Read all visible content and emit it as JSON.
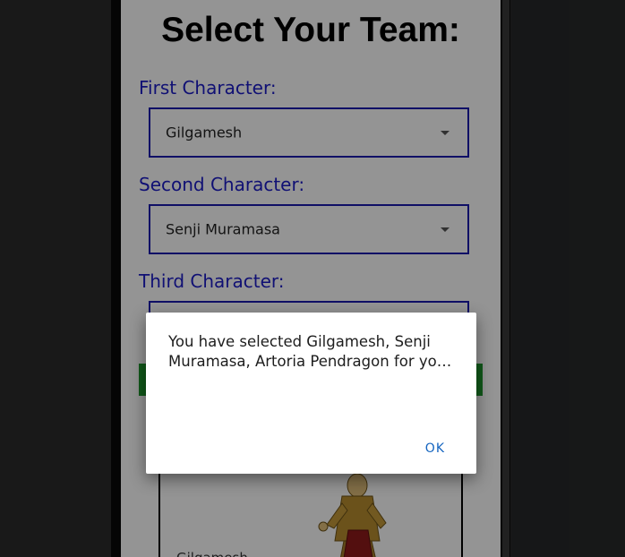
{
  "app": {
    "title": "Select Your Team:"
  },
  "characters": [
    {
      "label": "First Character:",
      "selected": "Gilgamesh"
    },
    {
      "label": "Second Character:",
      "selected": "Senji Muramasa"
    },
    {
      "label": "Third Character:",
      "selected": ""
    }
  ],
  "hero_card": {
    "name": "Gilgamesh"
  },
  "dialog": {
    "message": "You have selected Gilgamesh, Senji Muramasa, Artoria Pendragon for yo…",
    "ok_label": "OK"
  },
  "colors": {
    "label_blue": "#1c1cc8",
    "border_blue": "#1a1ab0",
    "button_green": "#1e9a2e",
    "ok_blue": "#1565c0"
  }
}
